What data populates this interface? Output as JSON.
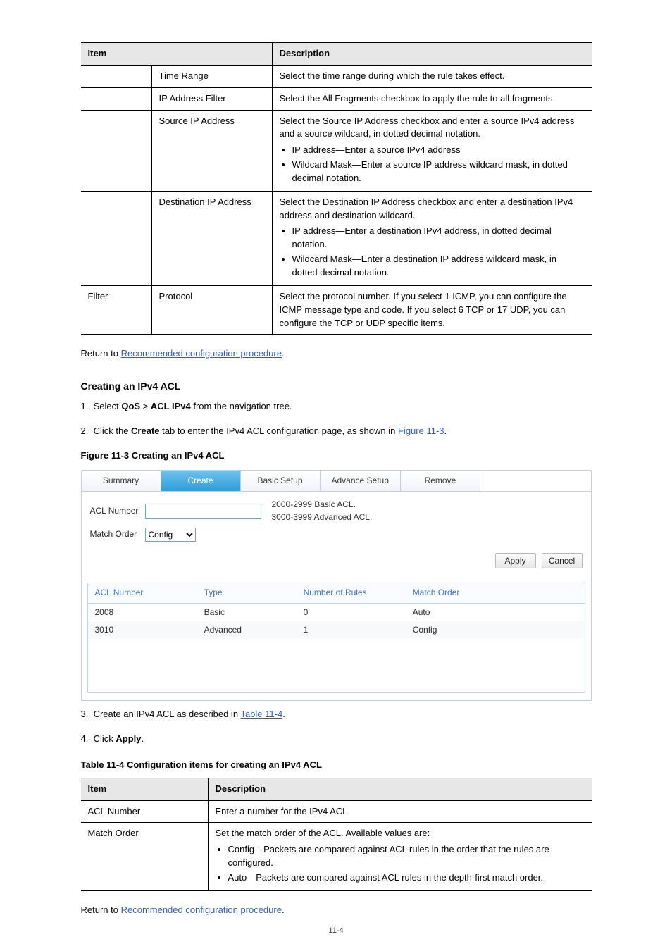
{
  "t113": {
    "head": [
      "Item",
      "Description"
    ],
    "rows": [
      {
        "item_main": "Time Range",
        "item_sub": "",
        "desc": "Select the time range during which the rule takes effect."
      },
      {
        "item_main": "",
        "item_sub": "IP Address Filter",
        "desc": "Select the All Fragments checkbox to apply the rule to all fragments."
      },
      {
        "item_main": "",
        "item_sub": "Source IP Address",
        "desc_intro": "Select the Source IP Address checkbox and enter a source IPv4 address and a source wildcard, in dotted decimal notation.",
        "bullets": [
          "IP address—Enter a source IPv4 address",
          "Wildcard Mask—Enter a source IP address wildcard mask, in dotted decimal notation."
        ]
      },
      {
        "item_main": "",
        "item_sub": "Destination IP Address",
        "desc_intro": "Select the Destination IP Address checkbox and enter a destination IPv4 address and destination wildcard.",
        "bullets": [
          "IP address—Enter a destination IPv4 address, in dotted decimal notation.",
          "Wildcard Mask—Enter a destination IP address wildcard mask, in dotted decimal notation."
        ]
      },
      {
        "item_main": "Filter",
        "item_sub": "Protocol",
        "desc": "Select the protocol number. If you select 1 ICMP, you can configure the ICMP message type and code. If you select 6 TCP or 17 UDP, you can configure the TCP or UDP specific items."
      }
    ]
  },
  "para1": {
    "pre": "Return to ",
    "link": "Recommended configuration procedure",
    "post": "."
  },
  "section_title": "Creating an IPv4 ACL",
  "step1": {
    "num": "1.",
    "pre": "Select ",
    "bold1": "QoS",
    "mid": " > ",
    "bold2": "ACL IPv4",
    "post": " from the navigation tree."
  },
  "step2": {
    "num": "2.",
    "pre": "Click the ",
    "bold": "Create",
    "mid": " tab to enter the IPv4 ACL configuration page, as shown in ",
    "link": "Figure 11-3",
    "post": "."
  },
  "figure_label": "Figure 11-3 Creating an IPv4 ACL",
  "figure": {
    "tabs": [
      {
        "label": "Summary",
        "selected": false
      },
      {
        "label": "Create",
        "selected": true
      },
      {
        "label": "Basic Setup",
        "selected": false
      },
      {
        "label": "Advance Setup",
        "selected": false
      },
      {
        "label": "Remove",
        "selected": false
      }
    ],
    "form": {
      "acl_label": "ACL Number",
      "acl_value": "",
      "hint": "2000-2999 Basic ACL.\n3000-3999 Advanced ACL.",
      "match_label": "Match Order",
      "match_value": "Config"
    },
    "buttons": {
      "apply": "Apply",
      "cancel": "Cancel"
    },
    "list": {
      "head": [
        "ACL Number",
        "Type",
        "Number of Rules",
        "Match Order"
      ],
      "rows": [
        [
          "2008",
          "Basic",
          "0",
          "Auto"
        ],
        [
          "3010",
          "Advanced",
          "1",
          "Config"
        ]
      ]
    }
  },
  "step3": {
    "num": "3.",
    "pre": "Create an IPv4 ACL as described in ",
    "link": "Table 11-4",
    "post": "."
  },
  "step4": {
    "num": "4.",
    "pre": "Click ",
    "bold": "Apply",
    "post": "."
  },
  "t114_label": "Table 11-4 Configuration items for creating an IPv4 ACL",
  "t114": {
    "head": [
      "Item",
      "Description"
    ],
    "rows": [
      {
        "item": "ACL Number",
        "desc": "Enter a number for the IPv4 ACL."
      },
      {
        "item": "Match Order",
        "desc_intro": "Set the match order of the ACL. Available values are:",
        "bullets": [
          "Config—Packets are compared against ACL rules in the order that the rules are configured.",
          "Auto—Packets are compared against ACL rules in the depth-first match order."
        ]
      }
    ]
  },
  "para2": {
    "pre": "Return to ",
    "link": "Recommended configuration procedure",
    "post": "."
  },
  "page_number": "11-4"
}
